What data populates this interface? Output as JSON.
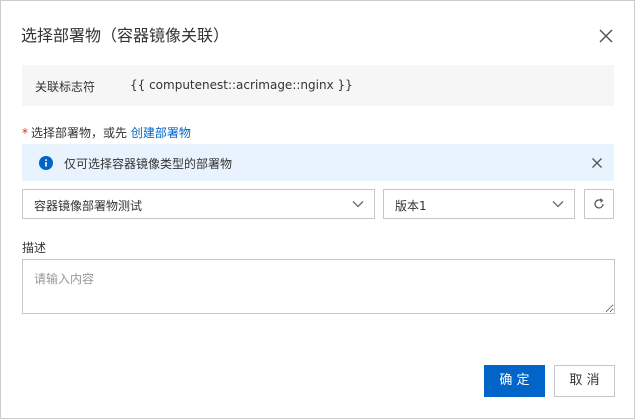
{
  "dialog": {
    "title": "选择部署物（容器镜像关联）"
  },
  "identifier": {
    "label": "关联标志符",
    "value": "{{ computenest::acrimage::nginx }}"
  },
  "deployable": {
    "required_mark": "*",
    "label": "选择部署物，或先",
    "create_link": "创建部署物"
  },
  "info_banner": {
    "text": "仅可选择容器镜像类型的部署物",
    "color": "#e8f3fd",
    "icon": "info-icon"
  },
  "selects": {
    "artifact": "容器镜像部署物测试",
    "version": "版本1"
  },
  "description": {
    "label": "描述",
    "placeholder": "请输入内容",
    "value": ""
  },
  "buttons": {
    "ok": "确 定",
    "cancel": "取 消"
  },
  "colors": {
    "primary": "#0064c8",
    "required": "#d93026"
  }
}
